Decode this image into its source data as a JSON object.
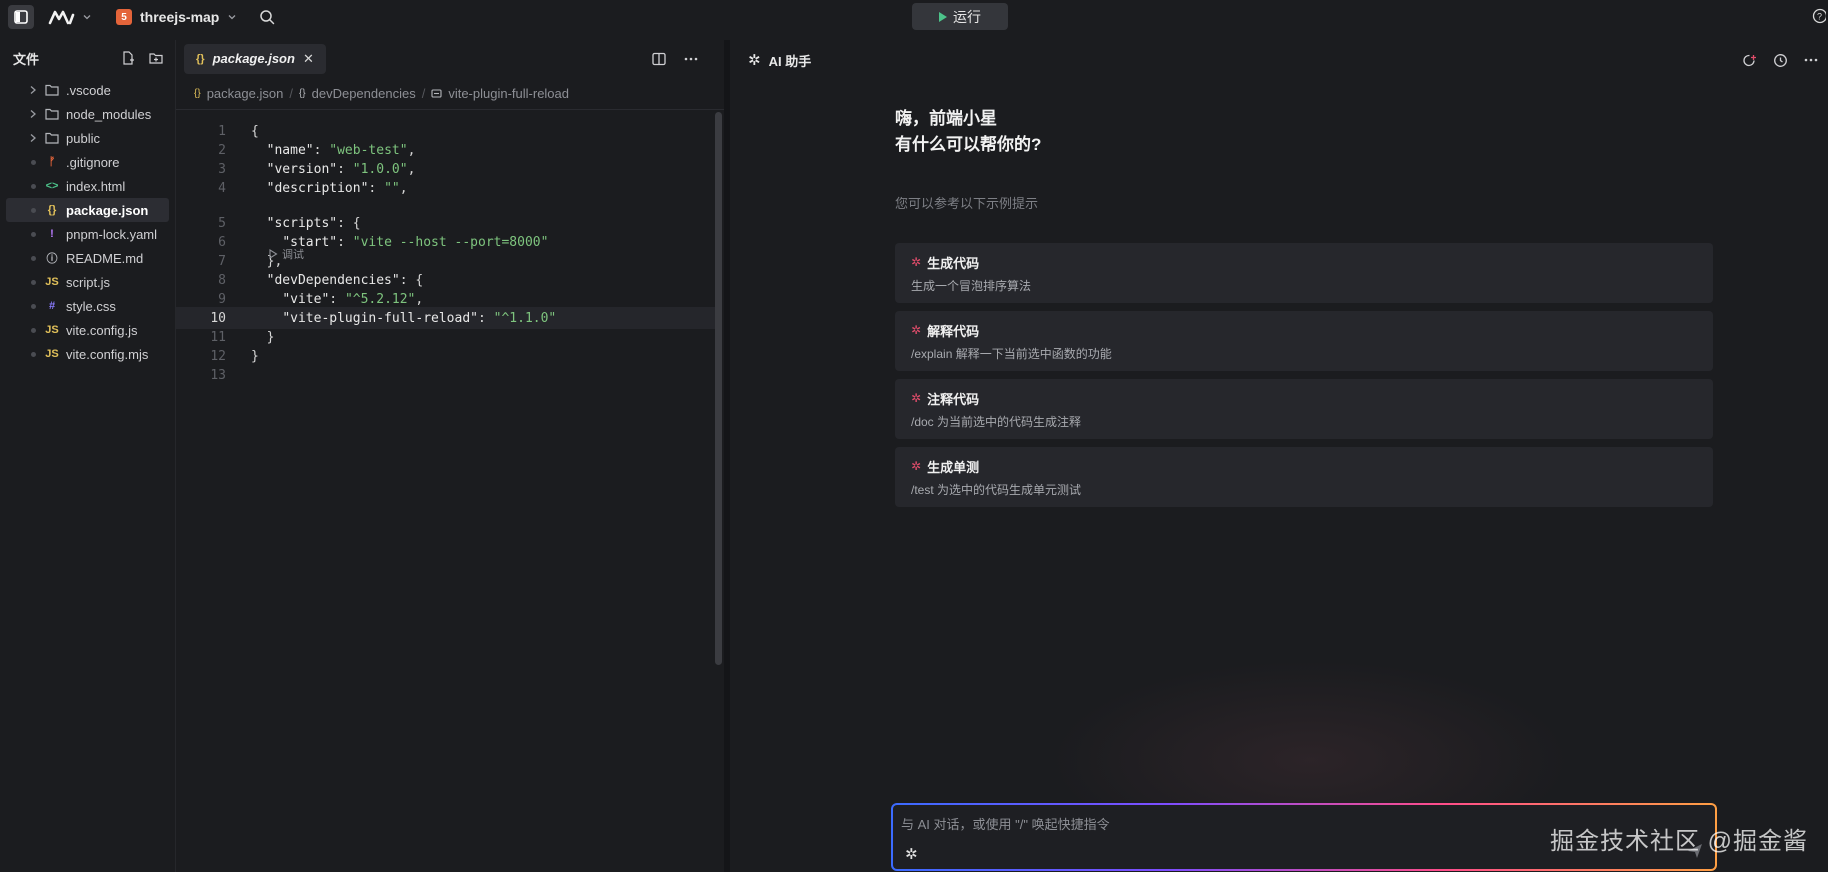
{
  "topbar": {
    "project_name": "threejs-map",
    "project_badge": "5",
    "run_label": "运行"
  },
  "sidebar": {
    "title": "文件",
    "items": [
      {
        "label": ".vscode",
        "kind": "folder"
      },
      {
        "label": "node_modules",
        "kind": "folder"
      },
      {
        "label": "public",
        "kind": "folder"
      },
      {
        "label": ".gitignore",
        "kind": "git",
        "icon": "ᚠ"
      },
      {
        "label": "index.html",
        "kind": "html",
        "icon": "<>"
      },
      {
        "label": "package.json",
        "kind": "json",
        "icon": "{}",
        "active": true
      },
      {
        "label": "pnpm-lock.yaml",
        "kind": "yaml",
        "icon": "!"
      },
      {
        "label": "README.md",
        "kind": "md",
        "icon": "ⓘ"
      },
      {
        "label": "script.js",
        "kind": "js",
        "icon": "JS"
      },
      {
        "label": "style.css",
        "kind": "css",
        "icon": "#"
      },
      {
        "label": "vite.config.js",
        "kind": "js",
        "icon": "JS"
      },
      {
        "label": "vite.config.mjs",
        "kind": "js",
        "icon": "JS"
      }
    ]
  },
  "editor": {
    "tab_label": "package.json",
    "breadcrumbs": [
      "package.json",
      "devDependencies",
      "vite-plugin-full-reload"
    ],
    "debug_hint": "调试",
    "lines": [
      {
        "n": "1",
        "html": "{"
      },
      {
        "n": "2",
        "html": "  \"name\": \"web-test\","
      },
      {
        "n": "3",
        "html": "  \"version\": \"1.0.0\","
      },
      {
        "n": "4",
        "html": "  \"description\": \"\","
      },
      {
        "n": "5",
        "html": "  \"scripts\": {"
      },
      {
        "n": "6",
        "html": "    \"start\": \"vite --host --port=8000\""
      },
      {
        "n": "7",
        "html": "  },"
      },
      {
        "n": "8",
        "html": "  \"devDependencies\": {"
      },
      {
        "n": "9",
        "html": "    \"vite\": \"^5.2.12\","
      },
      {
        "n": "10",
        "html": "    \"vite-plugin-full-reload\": \"^1.1.0\""
      },
      {
        "n": "11",
        "html": "  }"
      },
      {
        "n": "12",
        "html": "}"
      },
      {
        "n": "13",
        "html": ""
      }
    ],
    "current_line": "10"
  },
  "ai": {
    "title": "AI 助手",
    "greeting_line1": "嗨，前端小星",
    "greeting_line2": "有什么可以帮你的?",
    "hint": "您可以参考以下示例提示",
    "cards": [
      {
        "title": "生成代码",
        "desc": "生成一个冒泡排序算法"
      },
      {
        "title": "解释代码",
        "desc": "/explain 解释一下当前选中函数的功能"
      },
      {
        "title": "注释代码",
        "desc": "/doc 为当前选中的代码生成注释"
      },
      {
        "title": "生成单测",
        "desc": "/test 为选中的代码生成单元测试"
      }
    ],
    "input_placeholder": "与 AI 对话，或使用 \"/\" 唤起快捷指令",
    "watermark": "掘金技术社区 @掘金酱"
  },
  "colors": {
    "bg": "#1b1c1f",
    "string": "#7ec47e",
    "run_green": "#4cc38a",
    "html5_orange": "#e4643a"
  }
}
